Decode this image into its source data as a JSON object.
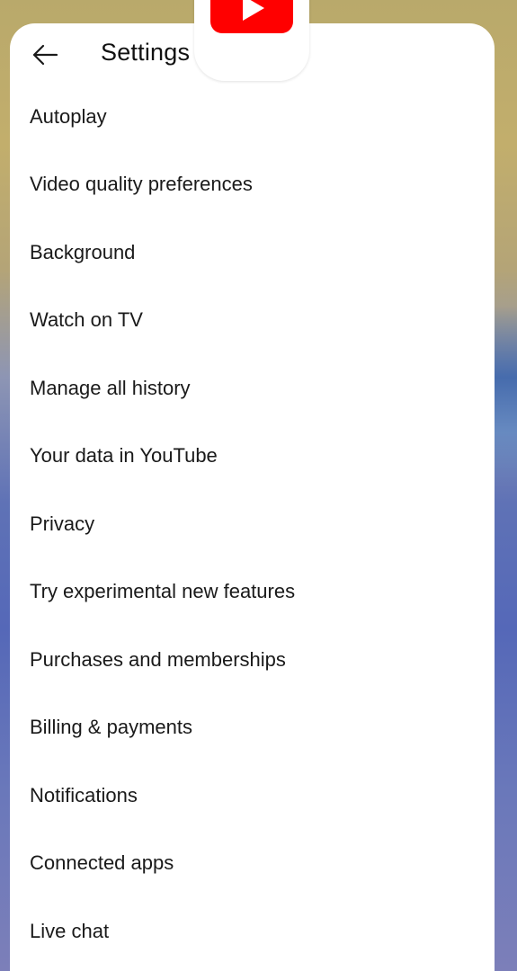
{
  "header": {
    "title": "Settings",
    "back_icon": "arrow-left-icon"
  },
  "app_badge": {
    "icon": "youtube-logo-icon",
    "accent_color": "#ff0000"
  },
  "menu": {
    "items": [
      {
        "label": "Autoplay"
      },
      {
        "label": "Video quality preferences"
      },
      {
        "label": "Background"
      },
      {
        "label": "Watch on TV"
      },
      {
        "label": "Manage all history"
      },
      {
        "label": "Your data in YouTube"
      },
      {
        "label": "Privacy"
      },
      {
        "label": "Try experimental new features"
      },
      {
        "label": "Purchases and memberships"
      },
      {
        "label": "Billing & payments"
      },
      {
        "label": "Notifications"
      },
      {
        "label": "Connected apps"
      },
      {
        "label": "Live chat"
      }
    ]
  }
}
